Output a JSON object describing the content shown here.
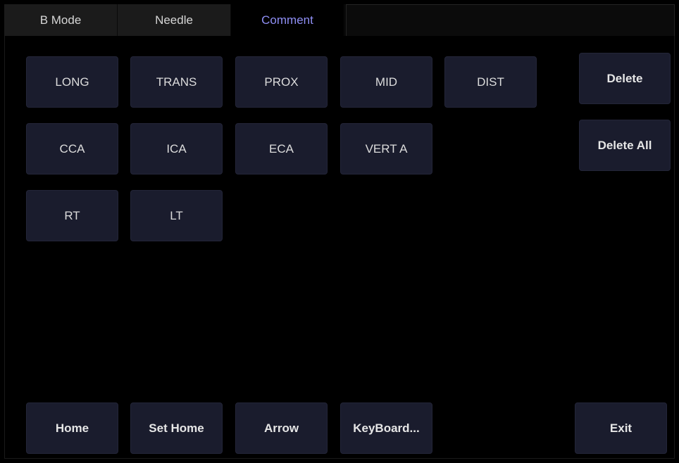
{
  "tabs": [
    {
      "label": "B Mode"
    },
    {
      "label": "Needle"
    },
    {
      "label": "Comment"
    }
  ],
  "comment_buttons": {
    "row1": [
      "LONG",
      "TRANS",
      "PROX",
      "MID",
      "DIST"
    ],
    "row2": [
      "CCA",
      "ICA",
      "ECA",
      "VERT A"
    ],
    "row3": [
      "RT",
      "LT"
    ]
  },
  "side_buttons": {
    "delete": "Delete",
    "delete_all": "Delete All"
  },
  "bottom_buttons": {
    "home": "Home",
    "set_home": "Set Home",
    "arrow": "Arrow",
    "keyboard": "KeyBoard...",
    "exit": "Exit"
  },
  "colors": {
    "background": "#000000",
    "button": "#1a1c2d",
    "active_tab_text": "#8f8ff5"
  }
}
